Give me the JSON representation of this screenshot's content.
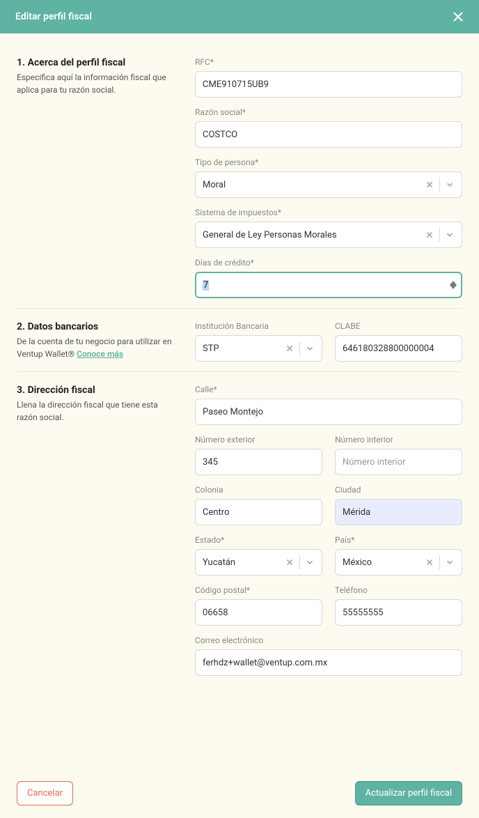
{
  "header": {
    "title": "Editar perfil fiscal"
  },
  "section1": {
    "title": "1. Acerca del perfil fiscal",
    "desc": "Especifica aquí la información fiscal que aplica para tu razón social.",
    "rfc_label": "RFC*",
    "rfc_value": "CME910715UB9",
    "razon_label": "Razón social*",
    "razon_value": "COSTCO",
    "tipo_label": "Tipo de persona*",
    "tipo_value": "Moral",
    "sistema_label": "Sistema de impuestos*",
    "sistema_value": "General de Ley Personas Morales",
    "dias_label": "Días de crédito*",
    "dias_value": "7"
  },
  "section2": {
    "title": "2. Datos bancarios",
    "desc_prefix": "De la cuenta de tu negocio para utilizar en Ventup Wallet® ",
    "desc_link": "Conoce más",
    "inst_label": "Institución Bancaria",
    "inst_value": "STP",
    "clabe_label": "CLABE",
    "clabe_value": "646180328800000004"
  },
  "section3": {
    "title": "3. Dirección fiscal",
    "desc": "Llena la dirección fiscal que tiene esta razón social.",
    "calle_label": "Calle*",
    "calle_value": "Paseo Montejo",
    "numext_label": "Número exterior",
    "numext_value": "345",
    "numint_label": "Número interior",
    "numint_placeholder": "Número interior",
    "colonia_label": "Colonia",
    "colonia_value": "Centro",
    "ciudad_label": "Ciudad",
    "ciudad_value": "Mérida",
    "estado_label": "Estado*",
    "estado_value": "Yucatán",
    "pais_label": "País*",
    "pais_value": "México",
    "cp_label": "Código postal*",
    "cp_value": "06658",
    "tel_label": "Teléfono",
    "tel_value": "55555555",
    "correo_label": "Correo electrónico",
    "correo_value": "ferhdz+wallet@ventup.com.mx"
  },
  "footer": {
    "cancel": "Cancelar",
    "submit": "Actualizar perfil fiscal"
  }
}
